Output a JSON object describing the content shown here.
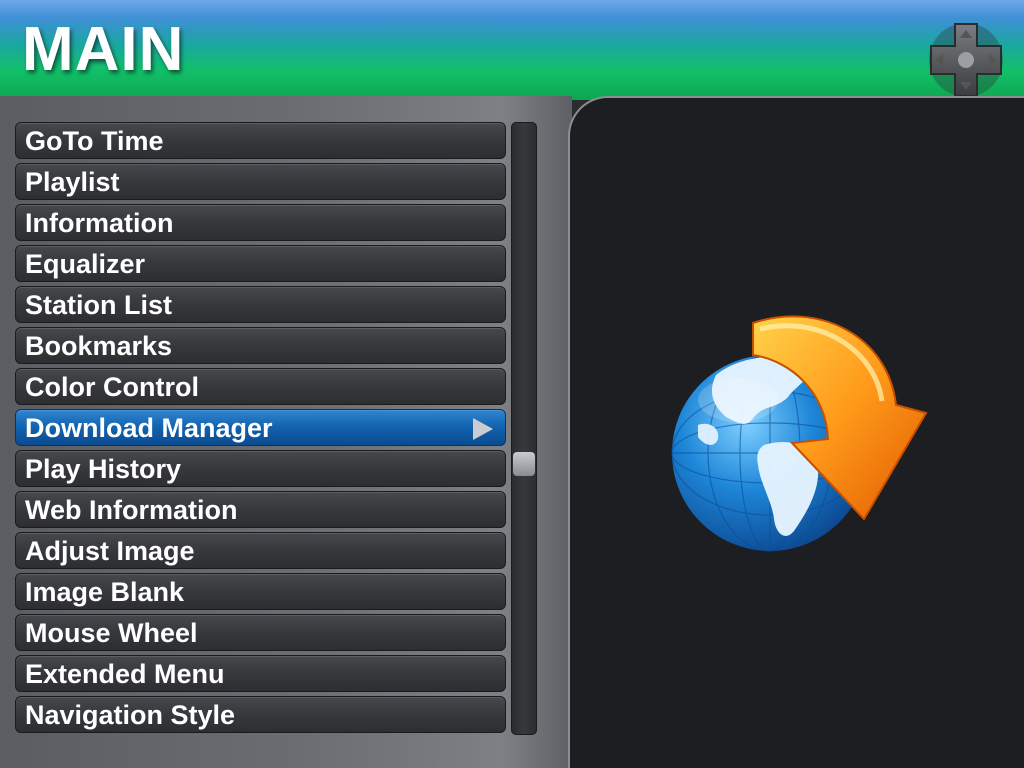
{
  "header": {
    "title": "MAIN"
  },
  "menu": {
    "items": [
      {
        "label": "GoTo Time"
      },
      {
        "label": "Playlist"
      },
      {
        "label": "Information"
      },
      {
        "label": "Equalizer"
      },
      {
        "label": "Station List"
      },
      {
        "label": "Bookmarks"
      },
      {
        "label": "Color Control"
      },
      {
        "label": "Download Manager"
      },
      {
        "label": "Play History"
      },
      {
        "label": "Web Information"
      },
      {
        "label": "Adjust Image"
      },
      {
        "label": "Image Blank"
      },
      {
        "label": "Mouse Wheel"
      },
      {
        "label": "Extended Menu"
      },
      {
        "label": "Navigation Style"
      }
    ],
    "selected_index": 7
  },
  "icons": {
    "dpad": "dpad-icon",
    "preview": "globe-download-icon",
    "submenu": "play-triangle-icon"
  },
  "colors": {
    "header_green": "#12c06a",
    "header_blue": "#3f8fd6",
    "selected_blue": "#1261ad",
    "panel_dark": "#1c1e21"
  }
}
